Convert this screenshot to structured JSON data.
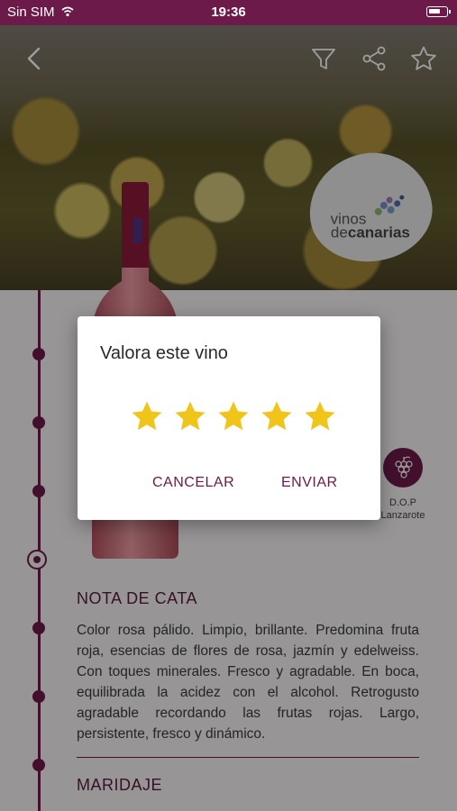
{
  "status_bar": {
    "carrier": "Sin SIM",
    "time": "19:36"
  },
  "logo": {
    "line1": "vinos",
    "line2_prefix": "de",
    "line2_bold": "canarias"
  },
  "badge": {
    "label_line1": "D.O.P",
    "label_line2": "Lanzarote"
  },
  "tasting": {
    "title": "NOTA DE CATA",
    "text": "Color rosa pálido. Limpio, brillante. Predomina fruta roja, esencias de flores de rosa, jazmín y edelweiss. Con toques minerales. Fresco y agradable. En boca, equilibrada la acidez con el alcohol. Retrogusto agradable recordando las frutas rojas. Largo, persistente, fresco y dinámico."
  },
  "pairing": {
    "title": "MARIDAJE"
  },
  "dialog": {
    "title": "Valora este vino",
    "rating": 5,
    "max_rating": 5,
    "cancel_label": "CANCELAR",
    "send_label": "ENVIAR"
  },
  "colors": {
    "brand": "#6b1a4a",
    "star": "#f0c419"
  },
  "icons": [
    "back-icon",
    "filter-icon",
    "share-icon",
    "star-outline-icon",
    "wifi-icon",
    "battery-icon",
    "grape-icon"
  ]
}
